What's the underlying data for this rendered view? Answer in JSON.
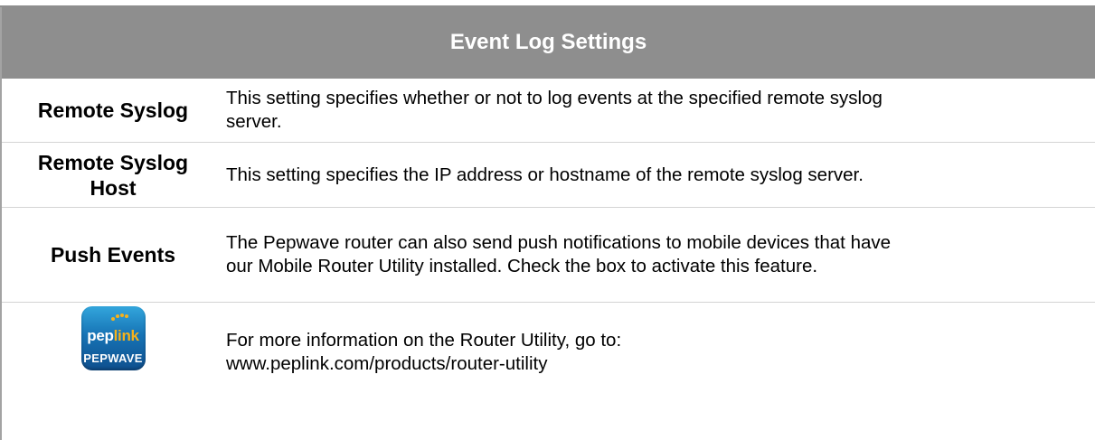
{
  "table": {
    "title": "Event Log Settings",
    "rows": [
      {
        "label": "Remote Syslog",
        "description": "This setting specifies whether or not to log events at the specified remote syslog\nserver."
      },
      {
        "label": "Remote Syslog\nHost",
        "description": "This setting specifies the IP address or hostname of the remote syslog server."
      },
      {
        "label": "Push Events",
        "description": "The Pepwave router can also send push notifications to mobile devices that have\nour Mobile Router Utility installed. Check the box to activate this feature."
      },
      {
        "logo": {
          "brand_a": "pep",
          "brand_b": "link",
          "sub": "PEPWAVE"
        },
        "description": "For more information on the Router Utility, go to:\nwww.peplink.com/products/router-utility"
      }
    ]
  },
  "colors": {
    "header_bg": "#8e8e8e",
    "row_divider": "#d4d4d4",
    "logo_accent": "#f6b21b"
  },
  "icons": {
    "logo": "peplink-pepwave-app-icon"
  }
}
